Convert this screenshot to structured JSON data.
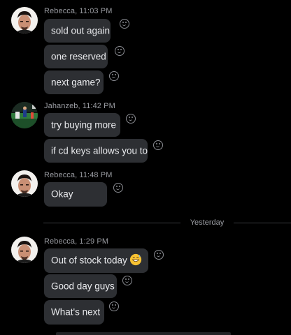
{
  "groups": [
    {
      "author": "Rebecca",
      "time": "11:03 PM",
      "meta": "Rebecca, 11:03 PM",
      "avatar": "rebecca-avatar",
      "messages": [
        "sold out again",
        "one reserved",
        "next game?"
      ]
    },
    {
      "author": "Jahanzeb",
      "time": "11:42 PM",
      "meta": "Jahanzeb, 11:42 PM",
      "avatar": "jahanzeb-avatar",
      "messages": [
        "try buying more",
        "if cd keys allows you to"
      ]
    },
    {
      "author": "Rebecca",
      "time": "11:48 PM",
      "meta": "Rebecca, 11:48 PM",
      "avatar": "rebecca-avatar",
      "messages": [
        "Okay"
      ]
    },
    {
      "author": "Rebecca",
      "time": "1:29 PM",
      "meta": "Rebecca, 1:29 PM",
      "avatar": "rebecca-avatar",
      "messages": [
        "Out of stock today",
        "Good day guys",
        "What's next"
      ],
      "emoji_on_first": "grinning-sweat-emoji"
    }
  ],
  "divider": {
    "label": "Yesterday"
  },
  "icons": {
    "reaction": "smiley-face-icon"
  },
  "colors": {
    "background": "#000000",
    "bubble": "#2d2f33",
    "text": "#e9eaed",
    "meta": "#9a9ca2"
  }
}
